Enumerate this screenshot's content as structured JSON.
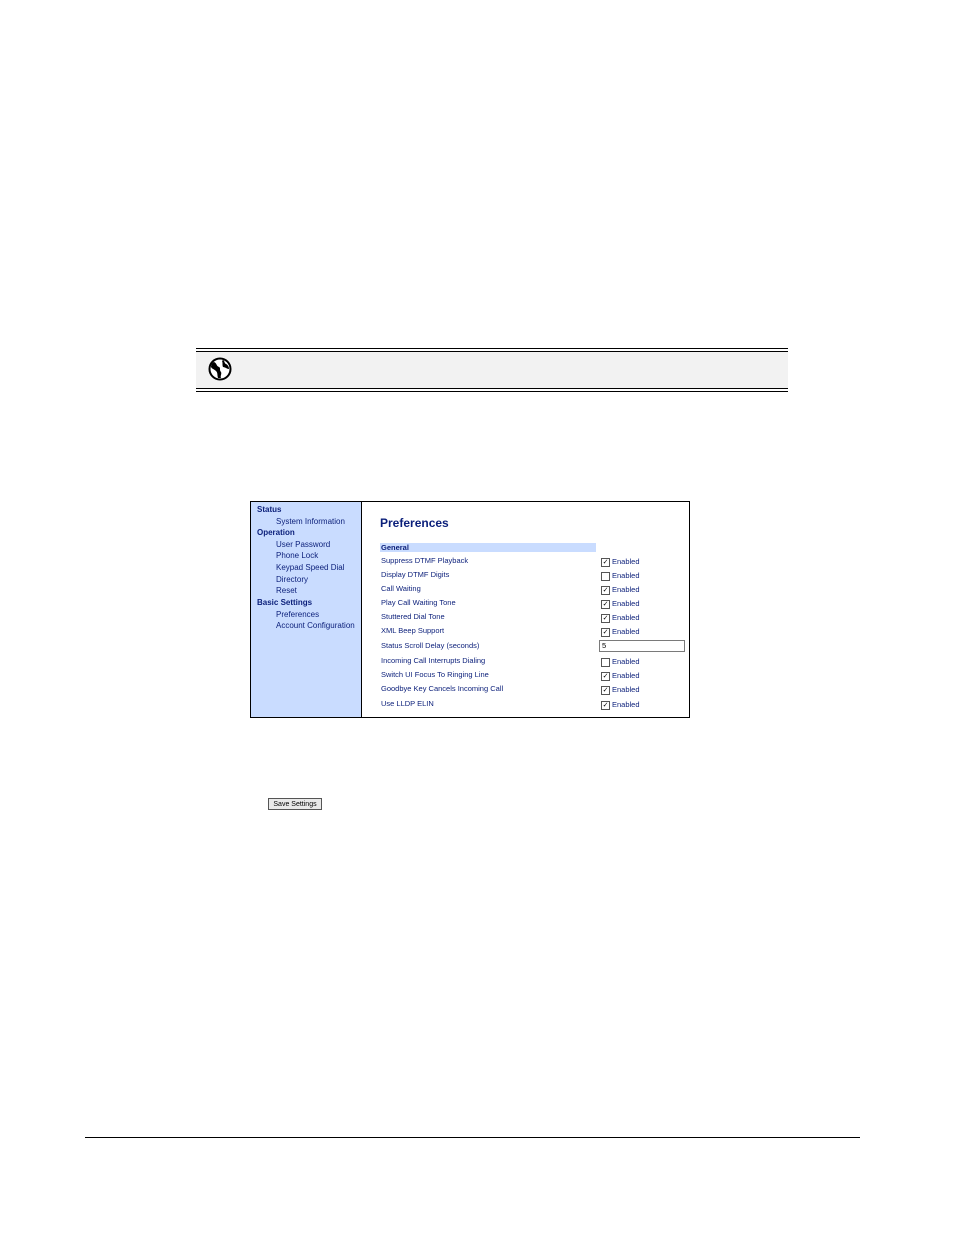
{
  "sidebar": {
    "items": [
      {
        "label": "Status",
        "type": "header"
      },
      {
        "label": "System Information",
        "type": "link"
      },
      {
        "label": "Operation",
        "type": "header"
      },
      {
        "label": "User Password",
        "type": "link"
      },
      {
        "label": "Phone Lock",
        "type": "link"
      },
      {
        "label": "Keypad Speed Dial",
        "type": "link"
      },
      {
        "label": "Directory",
        "type": "link"
      },
      {
        "label": "Reset",
        "type": "link"
      },
      {
        "label": "Basic Settings",
        "type": "header"
      },
      {
        "label": "Preferences",
        "type": "link"
      },
      {
        "label": "Account Configuration",
        "type": "link"
      }
    ]
  },
  "main": {
    "title": "Preferences",
    "section": "General",
    "rows": [
      {
        "label": "Suppress DTMF Playback",
        "control": "checkbox",
        "checked": true,
        "value": "Enabled"
      },
      {
        "label": "Display DTMF Digits",
        "control": "checkbox",
        "checked": false,
        "value": "Enabled"
      },
      {
        "label": "Call Waiting",
        "control": "checkbox",
        "checked": true,
        "value": "Enabled"
      },
      {
        "label": "Play Call Waiting Tone",
        "control": "checkbox",
        "checked": true,
        "value": "Enabled"
      },
      {
        "label": "Stuttered Dial Tone",
        "control": "checkbox",
        "checked": true,
        "value": "Enabled"
      },
      {
        "label": "XML Beep Support",
        "control": "checkbox",
        "checked": true,
        "value": "Enabled"
      },
      {
        "label": "Status Scroll Delay (seconds)",
        "control": "text",
        "value": "5"
      },
      {
        "label": "Incoming Call Interrupts Dialing",
        "control": "checkbox",
        "checked": false,
        "value": "Enabled"
      },
      {
        "label": "Switch UI Focus To Ringing Line",
        "control": "checkbox",
        "checked": true,
        "value": "Enabled"
      },
      {
        "label": "Goodbye Key Cancels Incoming Call",
        "control": "checkbox",
        "checked": true,
        "value": "Enabled"
      },
      {
        "label": "Use LLDP ELIN",
        "control": "checkbox",
        "checked": true,
        "value": "Enabled"
      }
    ]
  },
  "buttons": {
    "save_label": "Save Settings"
  },
  "icons": {
    "note": "globe-icon"
  },
  "colors": {
    "nav_text": "#0b1f7a",
    "sidebar_bg": "#c9dcff"
  }
}
